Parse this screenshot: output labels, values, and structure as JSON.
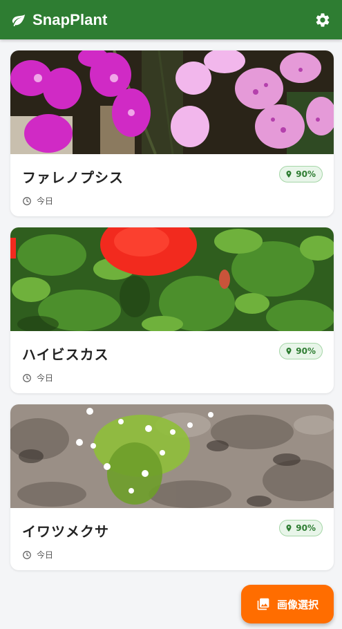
{
  "app": {
    "title": "SnapPlant",
    "brand_color": "#2e7d32",
    "accent_color": "#ff6d00",
    "icons": {
      "logo": "leaf-icon",
      "settings": "gear-icon"
    }
  },
  "plants": [
    {
      "name": "ファレノプシス",
      "confidence": "90%",
      "date": "今日",
      "photo": "pink-orchids"
    },
    {
      "name": "ハイビスカス",
      "confidence": "90%",
      "date": "今日",
      "photo": "red-hibiscus"
    },
    {
      "name": "イワツメクサ",
      "confidence": "90%",
      "date": "今日",
      "photo": "white-flowers-on-rock"
    }
  ],
  "fab": {
    "label": "画像選択",
    "icon": "image-gallery-icon"
  }
}
